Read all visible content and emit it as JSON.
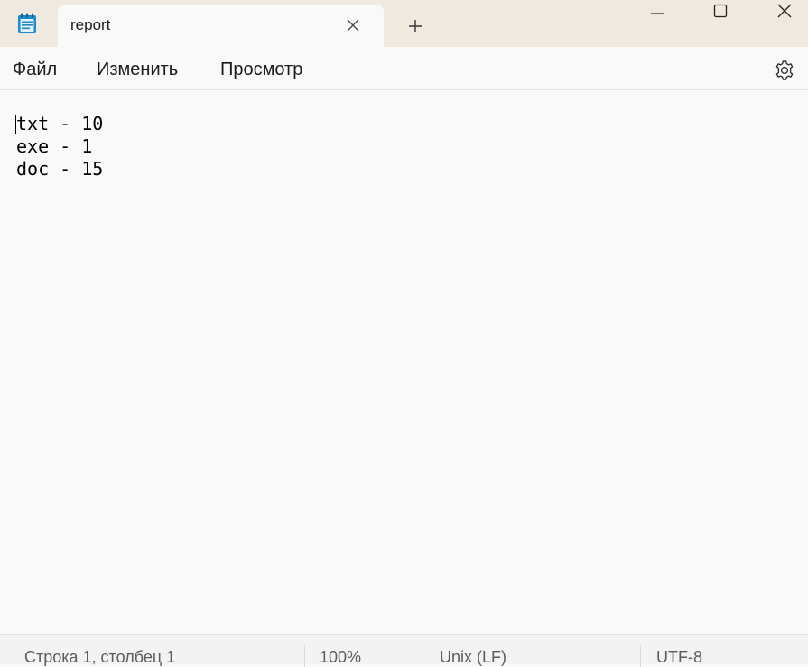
{
  "titlebar": {
    "app_icon": "notepad-icon",
    "tab_title": "report",
    "tab_close_icon": "close-icon",
    "new_tab_icon": "plus-icon",
    "window_controls": [
      "minimize-icon",
      "maximize-icon",
      "close-icon"
    ]
  },
  "menu": {
    "file": "Файл",
    "edit": "Изменить",
    "view": "Просмотр",
    "settings_icon": "gear-icon"
  },
  "editor": {
    "content": "txt - 10\nexe - 1\ndoc - 15"
  },
  "status": {
    "position": "Строка 1, столбец 1",
    "zoom": "100%",
    "line_ending": "Unix (LF)",
    "encoding": "UTF-8"
  },
  "colors": {
    "titlebar_bg": "#f0e9df",
    "window_bg": "#f9f9f9",
    "status_bg": "#f3f3f3",
    "app_icon_blue": "#1e88c9"
  }
}
